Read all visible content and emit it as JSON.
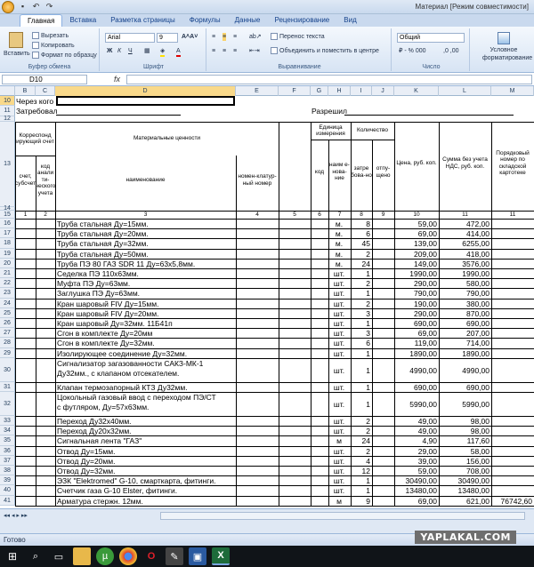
{
  "window": {
    "title": "Материал  [Режим совместимости]"
  },
  "tabs": [
    "Главная",
    "Вставка",
    "Разметка страницы",
    "Формулы",
    "Данные",
    "Рецензирование",
    "Вид"
  ],
  "ribbon": {
    "clipboard": {
      "paste": "Вставить",
      "cut": "Вырезать",
      "copy": "Копировать",
      "format_painter": "Формат по образцу",
      "label": "Буфер обмена"
    },
    "font": {
      "name": "Arial",
      "size": "9",
      "label": "Шрифт"
    },
    "alignment": {
      "wrap": "Перенос текста",
      "merge": "Объединить и поместить в центре",
      "label": "Выравнивание"
    },
    "number": {
      "format": "Общий",
      "label": "Число"
    },
    "styles": {
      "conditional": "Условное форматирование"
    }
  },
  "formula_bar": {
    "cell": "D10",
    "fx": "fx"
  },
  "columns": [
    "B",
    "C",
    "D",
    "E",
    "F",
    "G",
    "H",
    "I",
    "J",
    "K",
    "L",
    "M"
  ],
  "top_rows": {
    "r10_label": "Через кого",
    "r11_label": "Затребовал",
    "r11_right": "Разрешил"
  },
  "table_header": {
    "corr": "Корреспонд ирующий счет",
    "acc": "счет, субсчет",
    "code_an": "код анали ти-ческого учета",
    "mat": "Материальные ценности",
    "name": "наименование",
    "nomer": "номен-клатур-ный номер",
    "unit": "Единица измерения",
    "ucode": "код",
    "uname": "наим е-нова-ние",
    "qty": "Количество",
    "req": "затре бова-но",
    "rel": "отпу-щено",
    "price": "Цена, руб. коп.",
    "sum": "Сумма без учета НДС, руб. коп.",
    "order": "Порядковый номер по складской картотеке",
    "nums": [
      "1",
      "2",
      "3",
      "4",
      "5",
      "6",
      "7",
      "8",
      "9",
      "10",
      "11"
    ]
  },
  "rows": [
    {
      "n": "16",
      "name": "Труба стальная Ду=15мм.",
      "unit": "м.",
      "qty": "8",
      "price": "59,00",
      "sum": "472,00"
    },
    {
      "n": "17",
      "name": "Труба стальная Ду=20мм.",
      "unit": "м.",
      "qty": "6",
      "price": "69,00",
      "sum": "414,00"
    },
    {
      "n": "18",
      "name": "Труба стальная Ду=32мм.",
      "unit": "м.",
      "qty": "45",
      "price": "139,00",
      "sum": "6255,00"
    },
    {
      "n": "19",
      "name": "Труба стальная Ду=50мм.",
      "unit": "м.",
      "qty": "2",
      "price": "209,00",
      "sum": "418,00"
    },
    {
      "n": "20",
      "name": "Труба ПЭ 80 ГАЗ SDR 11 Ду=63х5,8мм.",
      "unit": "м.",
      "qty": "24",
      "price": "149,00",
      "sum": "3576,00"
    },
    {
      "n": "21",
      "name": "Седелка ПЭ 110х63мм.",
      "unit": "шт.",
      "qty": "1",
      "price": "1990,00",
      "sum": "1990,00"
    },
    {
      "n": "22",
      "name": "Муфта ПЭ Ду=63мм.",
      "unit": "шт.",
      "qty": "2",
      "price": "290,00",
      "sum": "580,00"
    },
    {
      "n": "23",
      "name": "Заглушка ПЭ Ду=63мм.",
      "unit": "шт.",
      "qty": "1",
      "price": "790,00",
      "sum": "790,00"
    },
    {
      "n": "24",
      "name": "Кран шаровый FIV Ду=15мм.",
      "unit": "шт.",
      "qty": "2",
      "price": "190,00",
      "sum": "380,00"
    },
    {
      "n": "25",
      "name": "Кран шаровый FIV Ду=20мм.",
      "unit": "шт.",
      "qty": "3",
      "price": "290,00",
      "sum": "870,00"
    },
    {
      "n": "26",
      "name": "Кран шаровый Ду=32мм. 11Б41п",
      "unit": "шт.",
      "qty": "1",
      "price": "690,00",
      "sum": "690,00"
    },
    {
      "n": "27",
      "name": "Сгон в комплекте Ду=20мм",
      "unit": "шт.",
      "qty": "3",
      "price": "69,00",
      "sum": "207,00"
    },
    {
      "n": "28",
      "name": "Сгон в комплекте Ду=32мм.",
      "unit": "шт.",
      "qty": "6",
      "price": "119,00",
      "sum": "714,00"
    },
    {
      "n": "29",
      "name": "Изолирующее соединение Ду=32мм.",
      "unit": "шт.",
      "qty": "1",
      "price": "1890,00",
      "sum": "1890,00"
    },
    {
      "n": "30",
      "name": "Сигнализатор загазованности САКЗ-МК-1",
      "name2": "Ду32мм., с клапаном отсекателем.",
      "unit": "шт.",
      "qty": "1",
      "price": "4990,00",
      "sum": "4990,00",
      "tall": true
    },
    {
      "n": "31",
      "name": "Клапан термозапорный КТЗ Ду32мм.",
      "unit": "шт.",
      "qty": "1",
      "price": "690,00",
      "sum": "690,00"
    },
    {
      "n": "32",
      "name": "Цокольный газовый ввод с переходом ПЭ/СТ",
      "name2": "с футляром, Ду=57х63мм.",
      "unit": "шт.",
      "qty": "1",
      "price": "5990,00",
      "sum": "5990,00",
      "tall": true
    },
    {
      "n": "33",
      "name": "Переход Ду32х40мм.",
      "unit": "шт.",
      "qty": "2",
      "price": "49,00",
      "sum": "98,00"
    },
    {
      "n": "34",
      "name": "Переход Ду20х32мм.",
      "unit": "шт.",
      "qty": "2",
      "price": "49,00",
      "sum": "98,00"
    },
    {
      "n": "35",
      "name": "Сигнальная лента \"ГАЗ\"",
      "unit": "м",
      "qty": "24",
      "price": "4,90",
      "sum": "117,60"
    },
    {
      "n": "36",
      "name": "Отвод  Ду=15мм.",
      "unit": "шт.",
      "qty": "2",
      "price": "29,00",
      "sum": "58,00"
    },
    {
      "n": "37",
      "name": "Отвод  Ду=20мм.",
      "unit": "шт.",
      "qty": "4",
      "price": "39,00",
      "sum": "156,00"
    },
    {
      "n": "38",
      "name": "Отвод  Ду=32мм.",
      "unit": "шт.",
      "qty": "12",
      "price": "59,00",
      "sum": "708,00"
    },
    {
      "n": "39",
      "name": "ЭЗК \"Elektromed\" G-10, смарткарта, фитинги.",
      "unit": "шт.",
      "qty": "1",
      "price": "30490,00",
      "sum": "30490,00"
    },
    {
      "n": "40",
      "name": "Счетчик газа G-10 Elster, фитинги.",
      "unit": "шт.",
      "qty": "1",
      "price": "13480,00",
      "sum": "13480,00"
    },
    {
      "n": "41",
      "name": "Арматура стержн. 12мм.",
      "unit": "м",
      "qty": "9",
      "price": "69,00",
      "sum": "621,00",
      "total": "76742,60"
    }
  ],
  "status": {
    "ready": "Готово"
  },
  "watermark": "YAPLAKAL.COM"
}
